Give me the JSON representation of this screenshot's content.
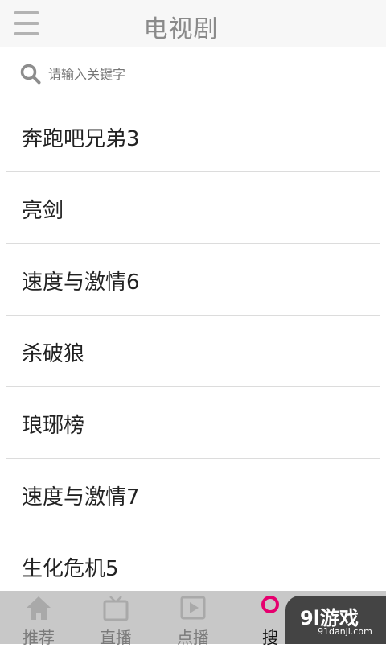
{
  "header": {
    "title": "电视剧",
    "menu_icon": "hamburger-menu-icon"
  },
  "search": {
    "placeholder": "请输入关键字",
    "icon": "search-icon"
  },
  "list": [
    "奔跑吧兄弟3",
    "亮剑",
    "速度与激情6",
    "杀破狼",
    "琅琊榜",
    "速度与激情7",
    "生化危机5"
  ],
  "tabbar": {
    "tabs": [
      {
        "label": "推荐",
        "icon": "home-icon"
      },
      {
        "label": "直播",
        "icon": "tv-icon"
      },
      {
        "label": "点播",
        "icon": "play-icon"
      },
      {
        "label": "搜",
        "icon": "search-icon",
        "active": true
      }
    ]
  },
  "watermark": {
    "main": "9l游戏",
    "sub": "91danji.com"
  },
  "colors": {
    "accent": "#e6006e",
    "tabbar_bg": "#c8c8c8"
  }
}
